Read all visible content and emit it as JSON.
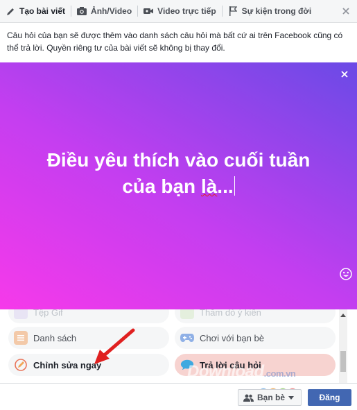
{
  "tabs": [
    {
      "label": "Tạo bài viết",
      "icon": "pencil-icon",
      "active": true
    },
    {
      "label": "Ảnh/Video",
      "icon": "camera-icon",
      "active": false
    },
    {
      "label": "Video trực tiếp",
      "icon": "video-camera-icon",
      "active": false
    },
    {
      "label": "Sự kiện trong đời",
      "icon": "flag-icon",
      "active": false
    }
  ],
  "notice": "Câu hỏi của bạn sẽ được thêm vào danh sách câu hỏi mà bất cứ ai trên Facebook cũng có thể trả lời. Quyền riêng tư của bài viết sẽ không bị thay đổi.",
  "question": {
    "line1": "Điều yêu thích vào cuối tuần",
    "line2_prefix": "của bạn ",
    "line2_marked": "là",
    "line2_suffix": "..."
  },
  "options": [
    {
      "label": "Tệp Gif",
      "icon": "gif-icon",
      "faded": true
    },
    {
      "label": "Thăm dò ý kiến",
      "icon": "poll-icon",
      "faded": true
    },
    {
      "label": "Danh sách",
      "icon": "list-icon",
      "faded": false
    },
    {
      "label": "Chơi với bạn bè",
      "icon": "gamepad-icon",
      "faded": false
    },
    {
      "label": "Chỉnh sửa ngay",
      "icon": "pencil-circle-icon",
      "faded": false
    },
    {
      "label": "Trả lời câu hỏi",
      "icon": "speech-bubble-icon",
      "faded": false,
      "highlighted": true
    }
  ],
  "footer": {
    "audience_label": "Bạn bè",
    "post_label": "Đăng"
  },
  "watermark": {
    "brand": "Download",
    "tld": ".com.vn"
  },
  "colors": {
    "primary": "#4267b2",
    "gradient_start": "#f639ea",
    "gradient_end": "#6a4ae6",
    "highlight": "#f7d3d0",
    "arrow": "#e02020"
  }
}
